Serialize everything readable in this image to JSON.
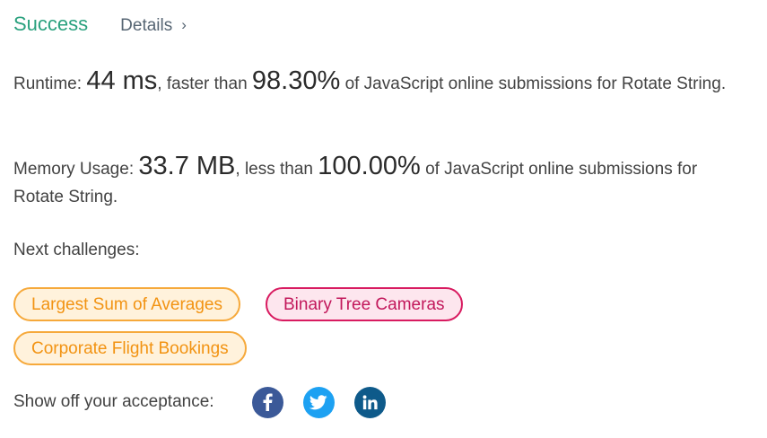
{
  "header": {
    "status": "Success",
    "details_label": "Details",
    "details_chevron": "›"
  },
  "runtime": {
    "label": "Runtime:",
    "value": "44 ms",
    "compare_text": ", faster than",
    "percent": "98.30%",
    "suffix": "of JavaScript online submissions for Rotate String."
  },
  "memory": {
    "label": "Memory Usage:",
    "value": "33.7 MB",
    "compare_text": ", less than",
    "percent": "100.00%",
    "suffix": "of JavaScript online submissions for Rotate String."
  },
  "next": {
    "label": "Next challenges:",
    "challenges": [
      {
        "title": "Largest Sum of Averages",
        "difficulty_color": "#f29312"
      },
      {
        "title": "Binary Tree Cameras",
        "difficulty_color": "#c2185b"
      },
      {
        "title": "Corporate Flight Bookings",
        "difficulty_color": "#f29312"
      }
    ]
  },
  "share": {
    "label": "Show off your acceptance:",
    "icons": [
      {
        "name": "facebook-icon",
        "color": "#3b5998"
      },
      {
        "name": "twitter-icon",
        "color": "#1da1f2"
      },
      {
        "name": "linkedin-icon",
        "color": "#0e5a8a"
      }
    ]
  },
  "colors": {
    "success": "#2aa17e",
    "medium": "#f29312",
    "hard": "#c2185b"
  }
}
